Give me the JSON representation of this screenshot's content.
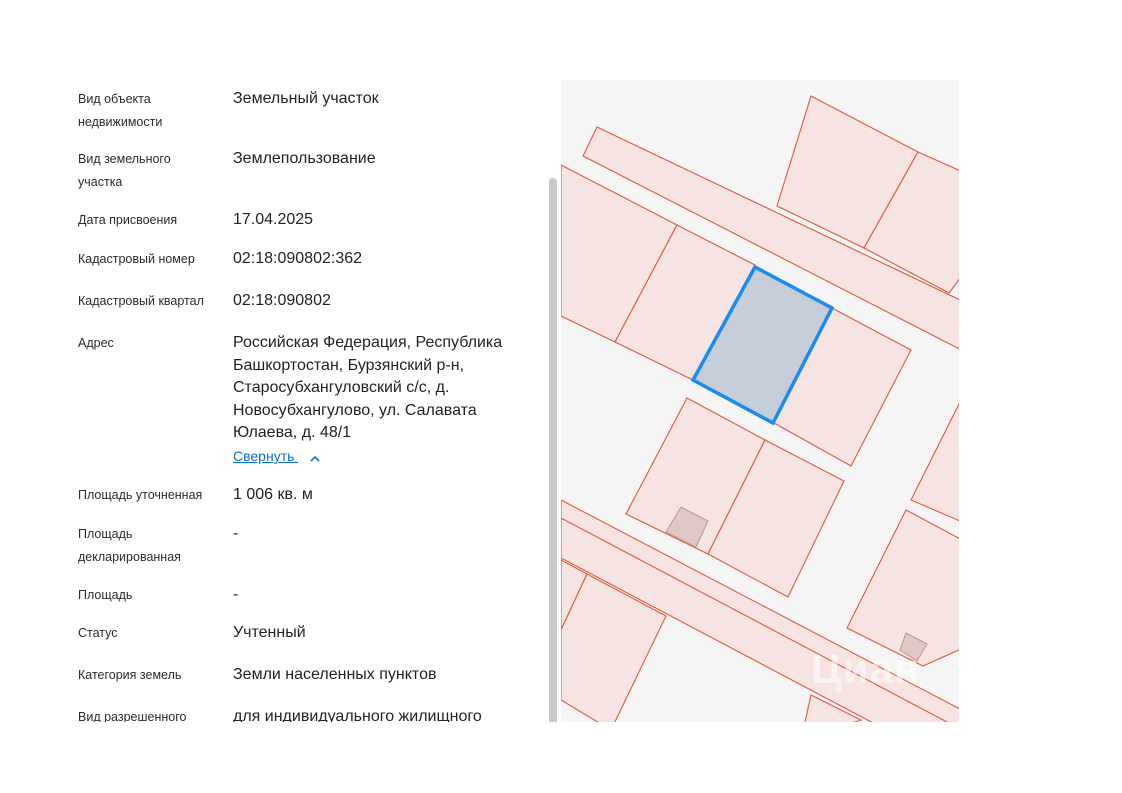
{
  "details": {
    "rows": [
      {
        "label": "Вид объекта недвижимости",
        "value": "Земельный участок"
      },
      {
        "label": "Вид земельного участка",
        "value": "Землепользование"
      },
      {
        "label": "Дата присвоения",
        "value": "17.04.2025"
      },
      {
        "label": "Кадастровый номер",
        "value": "02:18:090802:362"
      },
      {
        "label": "Кадастровый квартал",
        "value": "02:18:090802"
      },
      {
        "label": "Адрес",
        "value": "Российская Федерация, Республика Башкортостан, Бурзянский р-н, Старосубхангуловский с/с, д. Новосубхангулово, ул. Салавата Юлаева, д. 48/1"
      },
      {
        "label": "Площадь уточненная",
        "value": "1 006 кв. м"
      },
      {
        "label": "Площадь декларированная",
        "value": "-"
      },
      {
        "label": "Площадь",
        "value": "-"
      },
      {
        "label": "Статус",
        "value": "Учтенный"
      },
      {
        "label": "Категория земель",
        "value": "Земли населенных пунктов"
      },
      {
        "label": "Вид разрешенного",
        "value": "для индивидуального жилищного"
      }
    ],
    "collapse_label": "Свернуть"
  },
  "map": {
    "watermark": "Циан",
    "colors": {
      "background": "#f5f5f5",
      "parcel_fill": "#f5e4e1",
      "parcel_stroke": "#e0583e",
      "selected_fill": "#c5cdd8",
      "selected_stroke": "#1a8cf0",
      "building_fill": "#e0c8c4",
      "building_stroke": "#b39994"
    }
  },
  "colors": {
    "link": "#0a6fd6",
    "scrollbar": "#c9c9c9"
  }
}
